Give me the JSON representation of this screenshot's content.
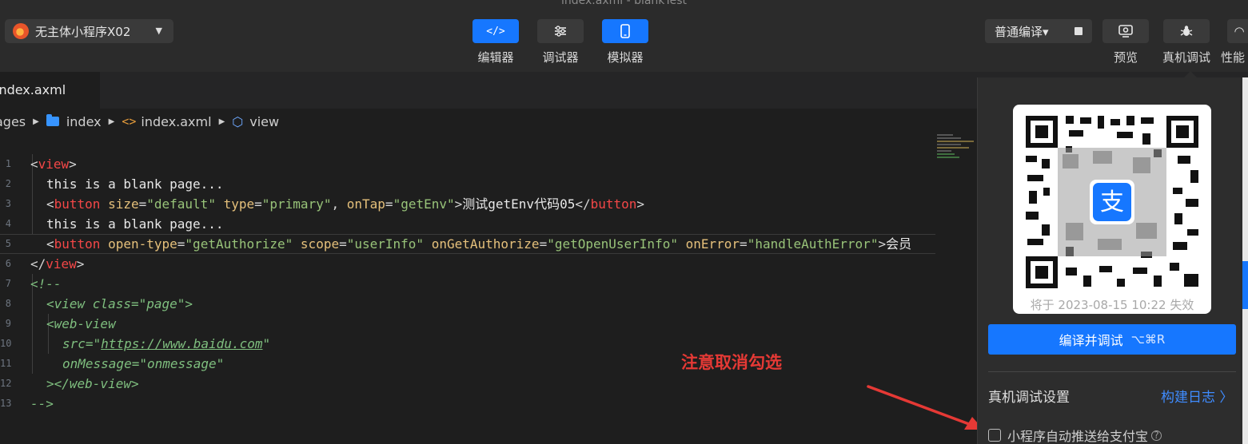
{
  "window": {
    "title": "index.axml - blankTest"
  },
  "toolbar": {
    "project_name": "无主体小程序X02",
    "modes": [
      {
        "label": "编辑器",
        "icon": "code-icon",
        "active": true
      },
      {
        "label": "调试器",
        "icon": "sliders-icon",
        "active": false
      },
      {
        "label": "模拟器",
        "icon": "phone-icon",
        "active": true
      }
    ],
    "compile_mode": "普通编译▾",
    "tools": [
      {
        "label": "预览",
        "icon": "preview-icon"
      },
      {
        "label": "真机调试",
        "icon": "bug-icon"
      },
      {
        "label": "性能",
        "icon": "performance-icon"
      }
    ]
  },
  "tabs": [
    {
      "label": "index.axml"
    }
  ],
  "breadcrumb": [
    "ages",
    "index",
    "index.axml",
    "view"
  ],
  "editor": {
    "lines": [
      "<view>",
      "  this is a blank page...",
      "  <button size=\"default\" type=\"primary\", onTap=\"getEnv\">测试getEnv代码05</button>",
      "  this is a blank page...",
      "  <button open-type=\"getAuthorize\" scope=\"userInfo\" onGetAuthorize=\"getOpenUserInfo\" onError=\"handleAuthError\">会员",
      "</view>",
      "<!--",
      "  <view class=\"page\">",
      "  <web-view",
      "    src=\"https://www.baidu.com\"",
      "    onMessage=\"onmessage\"",
      "  ></web-view>",
      "-->"
    ],
    "url_text": "https://www.baidu.com"
  },
  "annotation": {
    "text": "注意取消勾选",
    "color": "#e53935"
  },
  "debug_panel": {
    "qr_expire_text": "将于 2023-08-15 10:22 失效",
    "qr_center_glyph": "支",
    "compile_button": {
      "label": "编译并调试",
      "shortcut": "⌥⌘R"
    },
    "settings_title": "真机调试设置",
    "build_log_link": "构建日志 〉",
    "auto_push_checkbox": {
      "label": "小程序自动推送给支付宝",
      "checked": false
    }
  },
  "colors": {
    "accent": "#1677ff",
    "background": "#1e1e1e",
    "panel": "#2d2d2d"
  }
}
